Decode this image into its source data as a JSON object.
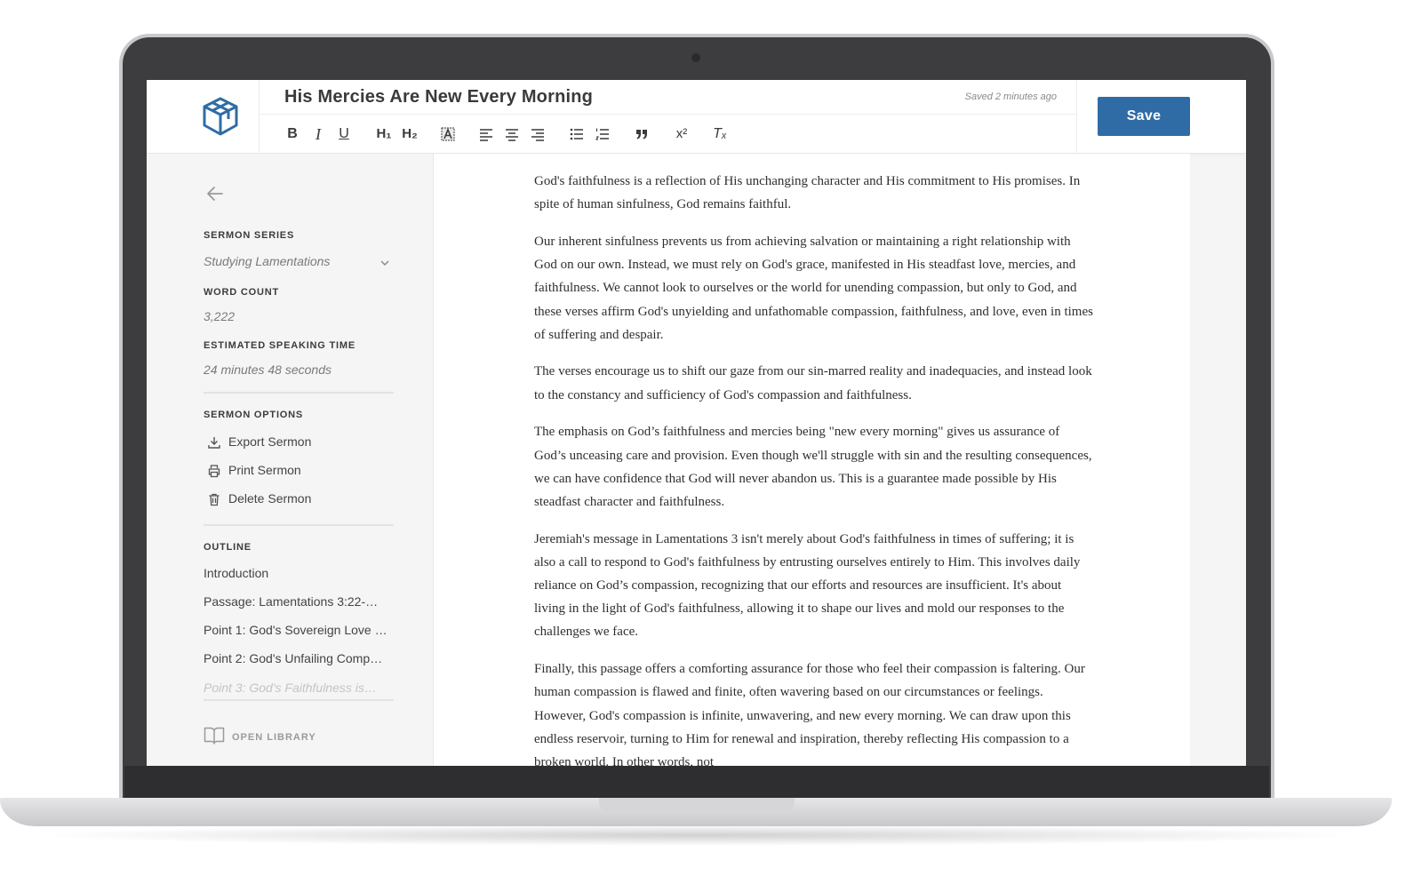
{
  "header": {
    "title": "His Mercies Are New Every Morning",
    "saved_status": "Saved 2 minutes ago",
    "save_label": "Save",
    "brand_color": "#2f6ca6"
  },
  "toolbar": {
    "buttons": [
      "bold",
      "italic",
      "underline",
      "heading-1",
      "heading-2",
      "text-color",
      "align-left",
      "align-center",
      "align-right",
      "bullet-list",
      "numbered-list",
      "quote",
      "superscript",
      "clear-format"
    ],
    "bold": "B",
    "italic": "I",
    "underline": "U",
    "h1": "H₁",
    "h2": "H₂",
    "superscript": "x²",
    "clear": "Tₓ"
  },
  "sidebar": {
    "series_label": "SERMON SERIES",
    "series_value": "Studying Lamentations",
    "word_count_label": "WORD COUNT",
    "word_count_value": "3,222",
    "speaking_time_label": "ESTIMATED SPEAKING TIME",
    "speaking_time_value": "24 minutes 48 seconds",
    "options_label": "SERMON OPTIONS",
    "options": [
      {
        "label": "Export Sermon",
        "icon": "download-icon"
      },
      {
        "label": "Print Sermon",
        "icon": "printer-icon"
      },
      {
        "label": "Delete Sermon",
        "icon": "trash-icon"
      }
    ],
    "outline_label": "OUTLINE",
    "outline": [
      "Introduction",
      "Passage: Lamentations 3:22-…",
      "Point 1: God's Sovereign Love …",
      "Point 2: God's Unfailing Comp…",
      "Point 3: God's Faithfulness is…"
    ],
    "library_label": "OPEN LIBRARY"
  },
  "document": {
    "paragraphs": [
      "God's faithfulness is a reflection of His unchanging character and His commitment to His promises. In spite of human sinfulness, God remains faithful.",
      "Our inherent sinfulness prevents us from achieving salvation or maintaining a right relationship with God on our own. Instead, we must rely on God's grace, manifested in His steadfast love, mercies, and faithfulness. We cannot look to ourselves or the world for unending compassion, but only to God, and these verses affirm God's unyielding and unfathomable compassion, faithfulness, and love, even in times of suffering and despair.",
      "The verses encourage us to shift our gaze from our sin-marred reality and inadequacies, and instead look to the constancy and sufficiency of God's compassion and faithfulness.",
      "The emphasis on God’s faithfulness and mercies being \"new every morning\" gives us assurance of God’s unceasing care and provision. Even though we'll struggle with sin and the resulting consequences, we can have confidence that God will never abandon us. This is a guarantee made possible by His steadfast character and faithfulness.",
      "Jeremiah's message in Lamentations 3 isn't merely about God's faithfulness in times of suffering; it is also a call to respond to God's faithfulness by entrusting ourselves entirely to Him. This involves daily reliance on God’s compassion, recognizing that our efforts and resources are insufficient. It's about living in the light of God's faithfulness, allowing it to shape our lives and mold our responses to the challenges we face.",
      "Finally, this passage offers a comforting assurance for those who feel their compassion is faltering. Our human compassion is flawed and finite, often wavering based on our circumstances or feelings. However, God's compassion is infinite, unwavering, and new every morning. We can draw upon this endless reservoir, turning to Him for renewal and inspiration, thereby reflecting His compassion to a broken world. In other words, not"
    ]
  }
}
